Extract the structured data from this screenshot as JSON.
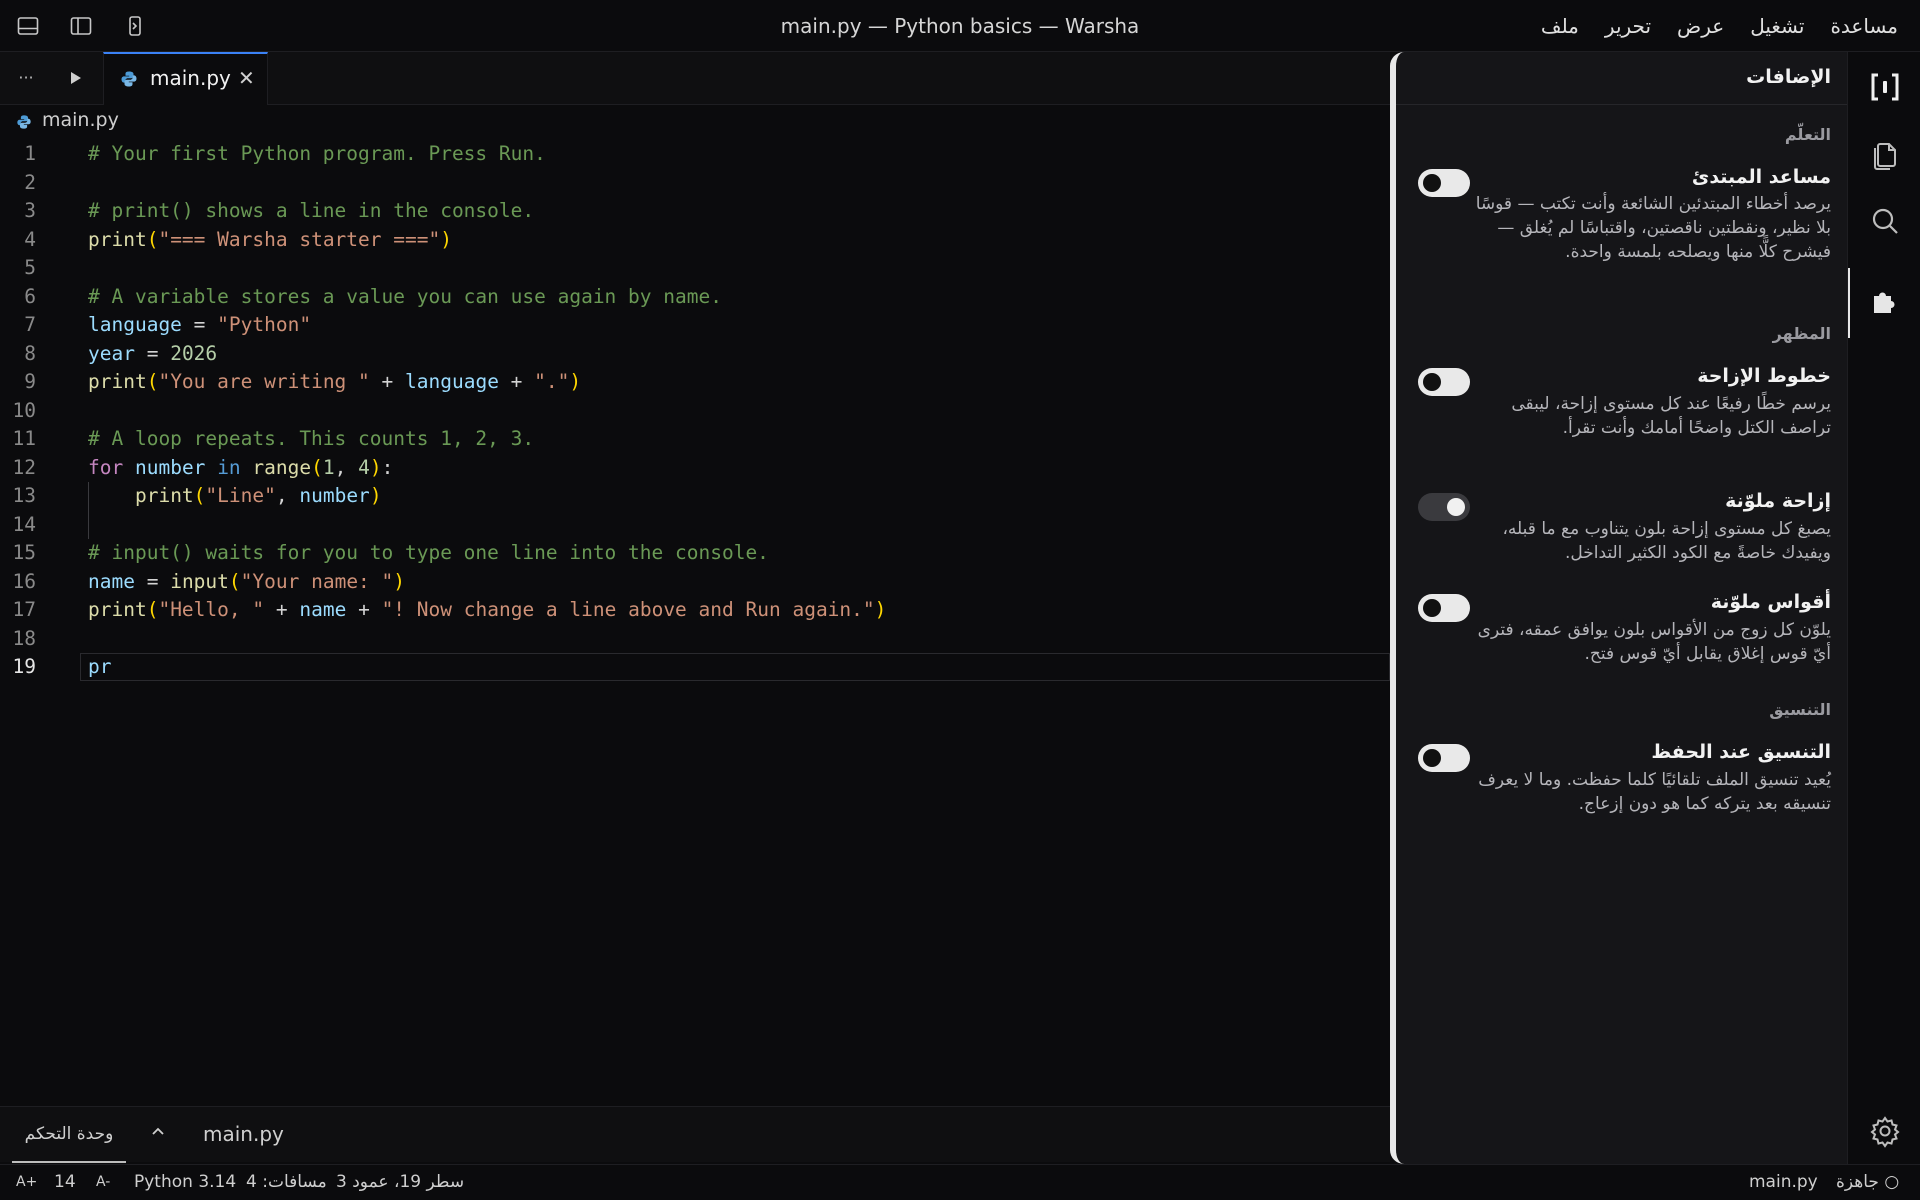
{
  "window": {
    "title": "main.py — Python basics — Warsha",
    "menu": [
      "ملف",
      "تحرير",
      "عرض",
      "تشغيل",
      "مساعدة"
    ]
  },
  "tab": {
    "label": "main.py",
    "close": "✕",
    "more": "···"
  },
  "breadcrumb": {
    "file": "main.py"
  },
  "editor": {
    "lines": [
      {
        "n": "1",
        "tokens": [
          [
            "cm",
            "# Your first Python program. Press Run."
          ]
        ]
      },
      {
        "n": "2",
        "tokens": []
      },
      {
        "n": "3",
        "tokens": [
          [
            "cm",
            "# print() shows a line in the console."
          ]
        ]
      },
      {
        "n": "4",
        "tokens": [
          [
            "fn",
            "print"
          ],
          [
            "pn",
            "("
          ],
          [
            "st",
            "\"=== Warsha starter ===\""
          ],
          [
            "pn",
            ")"
          ]
        ]
      },
      {
        "n": "5",
        "tokens": []
      },
      {
        "n": "6",
        "tokens": [
          [
            "cm",
            "# A variable stores a value you can use again by name."
          ]
        ]
      },
      {
        "n": "7",
        "tokens": [
          [
            "vr",
            "language"
          ],
          [
            "op",
            " = "
          ],
          [
            "st",
            "\"Python\""
          ]
        ]
      },
      {
        "n": "8",
        "tokens": [
          [
            "vr",
            "year"
          ],
          [
            "op",
            " = "
          ],
          [
            "nm",
            "2026"
          ]
        ]
      },
      {
        "n": "9",
        "tokens": [
          [
            "fn",
            "print"
          ],
          [
            "pn",
            "("
          ],
          [
            "st",
            "\"You are writing \""
          ],
          [
            "op",
            " + "
          ],
          [
            "vr",
            "language"
          ],
          [
            "op",
            " + "
          ],
          [
            "st",
            "\".\""
          ],
          [
            "pn",
            ")"
          ]
        ]
      },
      {
        "n": "10",
        "tokens": []
      },
      {
        "n": "11",
        "tokens": [
          [
            "cm",
            "# A loop repeats. This counts 1, 2, 3."
          ]
        ]
      },
      {
        "n": "12",
        "tokens": [
          [
            "kw",
            "for"
          ],
          [
            "tx",
            " "
          ],
          [
            "vr",
            "number"
          ],
          [
            "tx",
            " "
          ],
          [
            "kb",
            "in"
          ],
          [
            "tx",
            " "
          ],
          [
            "fn",
            "range"
          ],
          [
            "pn",
            "("
          ],
          [
            "nm",
            "1"
          ],
          [
            "tx",
            ", "
          ],
          [
            "nm",
            "4"
          ],
          [
            "pn",
            ")"
          ],
          [
            "tx",
            ":"
          ]
        ]
      },
      {
        "n": "13",
        "tokens": [
          [
            "tx",
            "    "
          ],
          [
            "fn",
            "print"
          ],
          [
            "pn",
            "("
          ],
          [
            "st",
            "\"Line\""
          ],
          [
            "tx",
            ", "
          ],
          [
            "vr",
            "number"
          ],
          [
            "pn",
            ")"
          ]
        ]
      },
      {
        "n": "14",
        "tokens": []
      },
      {
        "n": "15",
        "tokens": [
          [
            "cm",
            "# input() waits for you to type one line into the console."
          ]
        ]
      },
      {
        "n": "16",
        "tokens": [
          [
            "vr",
            "name"
          ],
          [
            "op",
            " = "
          ],
          [
            "fn",
            "input"
          ],
          [
            "pn",
            "("
          ],
          [
            "st",
            "\"Your name: \""
          ],
          [
            "pn",
            ")"
          ]
        ]
      },
      {
        "n": "17",
        "tokens": [
          [
            "fn",
            "print"
          ],
          [
            "pn",
            "("
          ],
          [
            "st",
            "\"Hello, \""
          ],
          [
            "op",
            " + "
          ],
          [
            "vr",
            "name"
          ],
          [
            "op",
            " + "
          ],
          [
            "st",
            "\"! Now change a line above and Run again.\""
          ],
          [
            "pn",
            ")"
          ]
        ]
      },
      {
        "n": "18",
        "tokens": []
      },
      {
        "n": "19",
        "tokens": [
          [
            "vr",
            "pr"
          ]
        ]
      }
    ],
    "active_line": "19"
  },
  "panel": {
    "console_tab": "وحدة التحكم",
    "file": "main.py"
  },
  "status": {
    "font_up": "A+",
    "font_size": "14",
    "font_down": "A-",
    "language": "Python 3.14",
    "spaces": "مسافات: 4",
    "position": "سطر 19، عمود 3",
    "file": "main.py",
    "ready": "○ جاهزة"
  },
  "extensions": {
    "title": "الإضافات",
    "sections": [
      {
        "heading": "التعلّم"
      },
      {
        "heading": "المظهر"
      },
      {
        "heading": "التنسيق"
      }
    ],
    "items": [
      {
        "title": "مساعد المبتدئ",
        "desc": "يرصد أخطاء المبتدئين الشائعة وأنت تكتب — قوسًا بلا نظير، ونقطتين ناقصتين، واقتباسًا لم يُغلق — فيشرح كلًّا منها ويصلحه بلمسة واحدة.",
        "enabled": false
      },
      {
        "title": "خطوط الإزاحة",
        "desc": "يرسم خطًا رفيعًا عند كل مستوى إزاحة، ليبقى تراصف الكتل واضحًا أمامك وأنت تقرأ.",
        "enabled": false
      },
      {
        "title": "إزاحة ملوّنة",
        "desc": "يصبغ كل مستوى إزاحة بلون يتناوب مع ما قبله، ويفيدك خاصةً مع الكود الكثير التداخل.",
        "enabled": true
      },
      {
        "title": "أقواس ملوّنة",
        "desc": "يلوّن كل زوج من الأقواس بلون يوافق عمقه، فترى أيّ قوس إغلاق يقابل أيّ قوس فتح.",
        "enabled": false
      },
      {
        "title": "التنسيق عند الحفظ",
        "desc": "يُعيد تنسيق الملف تلقائيًا كلما حفظت. وما لا يعرف تنسيقه بعد يتركه كما هو دون إزعاج.",
        "enabled": false
      }
    ]
  },
  "colors": {
    "accent": "#3b82f6",
    "background": "#0b0b0d",
    "panel": "#151518"
  }
}
